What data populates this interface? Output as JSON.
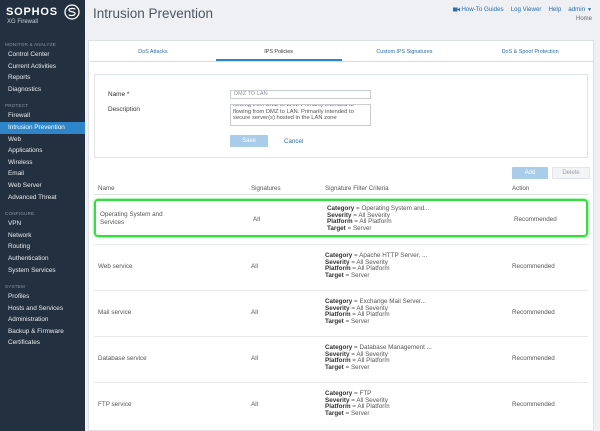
{
  "brand": {
    "name": "SOPHOS",
    "subtitle": "XG Firewall"
  },
  "sidebar": {
    "sections": [
      {
        "title": "Monitor & Analyze",
        "items": [
          "Control Center",
          "Current Activities",
          "Reports",
          "Diagnostics"
        ]
      },
      {
        "title": "Protect",
        "items": [
          "Firewall",
          "Intrusion Prevention",
          "Web",
          "Applications",
          "Wireless",
          "Email",
          "Web Server",
          "Advanced Threat"
        ]
      },
      {
        "title": "Configure",
        "items": [
          "VPN",
          "Network",
          "Routing",
          "Authentication",
          "System Services"
        ]
      },
      {
        "title": "System",
        "items": [
          "Profiles",
          "Hosts and Services",
          "Administration",
          "Backup & Firmware",
          "Certificates"
        ]
      }
    ],
    "active": "Intrusion Prevention"
  },
  "header": {
    "title": "Intrusion Prevention",
    "links": {
      "how_to": "How-To Guides",
      "log_viewer": "Log Viewer",
      "help": "Help",
      "admin": "admin"
    },
    "home": "Home"
  },
  "tabs": [
    "DoS Attacks",
    "IPS Policies",
    "Custom IPS Signatures",
    "DoS & Spoof Protection"
  ],
  "active_tab": "IPS Policies",
  "form": {
    "name_label": "Name *",
    "name_value": "DMZ TO LAN",
    "description_label": "Description",
    "description_text": "flowing from DMZ to LAN. Primarily intended to flowing from DMZ to LAN. Primarily intended to secure server(s) hosted in the LAN zone",
    "save_label": "Save",
    "cancel_label": "Cancel"
  },
  "table_actions": {
    "add": "Add",
    "delete": "Delete"
  },
  "table": {
    "columns": [
      "Name",
      "Signatures",
      "Signature Filter Criteria",
      "Action"
    ],
    "criteria_keys": {
      "category": "Category",
      "severity": "Severity",
      "platform": "Platform",
      "target": "Target"
    },
    "rows": [
      {
        "name": "Operating System and Services",
        "signatures": "All",
        "category": "= Operating System and...",
        "severity": "= All Severity",
        "platform": "= All Platform",
        "target": "= Server",
        "action": "Recommended"
      },
      {
        "name": "Web service",
        "signatures": "All",
        "category": "= Apache HTTP Server, ...",
        "severity": "= All Severity",
        "platform": "= All Platform",
        "target": "= Server",
        "action": "Recommended"
      },
      {
        "name": "Mail service",
        "signatures": "All",
        "category": "= Exchange Mail Server...",
        "severity": "= All Severity",
        "platform": "= All Platform",
        "target": "= Server",
        "action": "Recommended"
      },
      {
        "name": "Database service",
        "signatures": "All",
        "category": "= Database Management ...",
        "severity": "= All Severity",
        "platform": "= All Platform",
        "target": "= Server",
        "action": "Recommended"
      },
      {
        "name": "FTP service",
        "signatures": "All",
        "category": "= FTP",
        "severity": "= All Severity",
        "platform": "= All Platform",
        "target": "= Server",
        "action": "Recommended"
      }
    ]
  },
  "colors": {
    "sidebar_bg": "#23303f",
    "active_nav": "#2e86c9",
    "link": "#2b6ea8",
    "highlight": "#31e03f"
  }
}
